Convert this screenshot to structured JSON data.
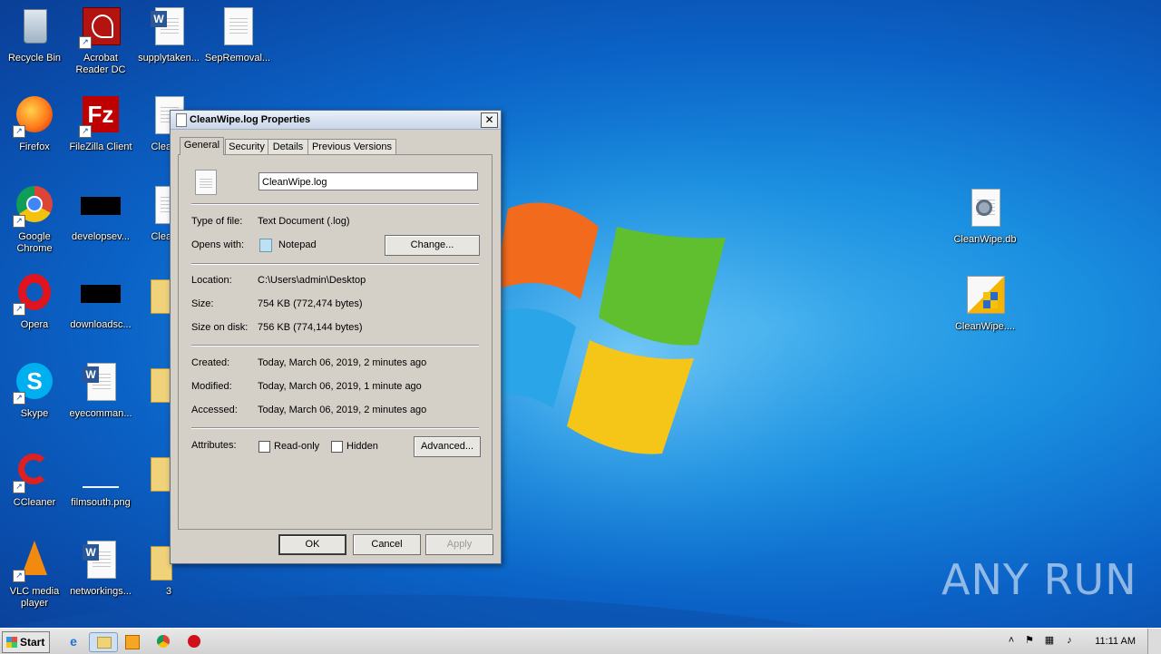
{
  "desktop": {
    "icons": [
      {
        "label": "Recycle Bin",
        "icon": "recycle-bin-icon"
      },
      {
        "label": "Acrobat Reader DC",
        "icon": "acrobat-icon"
      },
      {
        "label": "supplytaken...",
        "icon": "word-doc-icon"
      },
      {
        "label": "SepRemoval...",
        "icon": "text-file-icon"
      },
      {
        "label": "Firefox",
        "icon": "firefox-icon"
      },
      {
        "label": "FileZilla Client",
        "icon": "filezilla-icon"
      },
      {
        "label": "CleanW",
        "icon": "text-file-icon"
      },
      {
        "label": "Google Chrome",
        "icon": "chrome-icon"
      },
      {
        "label": "developsev...",
        "icon": "black-thumbnail-icon"
      },
      {
        "label": "CleanW",
        "icon": "settings-file-icon"
      },
      {
        "label": "Opera",
        "icon": "opera-icon"
      },
      {
        "label": "downloadsc...",
        "icon": "black-thumbnail-icon"
      },
      {
        "label": "Skype",
        "icon": "skype-icon"
      },
      {
        "label": "eyecomman...",
        "icon": "word-doc-icon"
      },
      {
        "label": "CCleaner",
        "icon": "ccleaner-icon"
      },
      {
        "label": "filmsouth.png",
        "icon": "image-file-icon"
      },
      {
        "label": "VLC media player",
        "icon": "vlc-icon"
      },
      {
        "label": "networkings...",
        "icon": "word-doc-icon"
      },
      {
        "label": "3",
        "icon": "folder-icon"
      },
      {
        "label": "CleanWipe.db",
        "icon": "settings-file-icon"
      },
      {
        "label": "CleanWipe....",
        "icon": "installer-icon"
      }
    ]
  },
  "dialog": {
    "title": "CleanWipe.log Properties",
    "tabs": [
      "General",
      "Security",
      "Details",
      "Previous Versions"
    ],
    "filename": "CleanWipe.log",
    "type_label": "Type of file:",
    "type_value": "Text Document (.log)",
    "opens_label": "Opens with:",
    "opens_value": "Notepad",
    "change_button": "Change...",
    "location_label": "Location:",
    "location_value": "C:\\Users\\admin\\Desktop",
    "size_label": "Size:",
    "size_value": "754 KB (772,474 bytes)",
    "size_disk_label": "Size on disk:",
    "size_disk_value": "756 KB (774,144 bytes)",
    "created_label": "Created:",
    "created_value": "Today, March 06, 2019, 2 minutes ago",
    "modified_label": "Modified:",
    "modified_value": "Today, March 06, 2019, 1 minute ago",
    "accessed_label": "Accessed:",
    "accessed_value": "Today, March 06, 2019, 2 minutes ago",
    "attributes_label": "Attributes:",
    "readonly_label": "Read-only",
    "hidden_label": "Hidden",
    "advanced_button": "Advanced...",
    "ok_button": "OK",
    "cancel_button": "Cancel",
    "apply_button": "Apply",
    "close_glyph": "✕"
  },
  "taskbar": {
    "start_label": "Start",
    "clock": "11:11 AM",
    "pinned": [
      "internet-explorer-icon",
      "file-explorer-icon",
      "media-player-icon",
      "chrome-icon",
      "opera-icon"
    ]
  },
  "watermark": "ANY RUN"
}
